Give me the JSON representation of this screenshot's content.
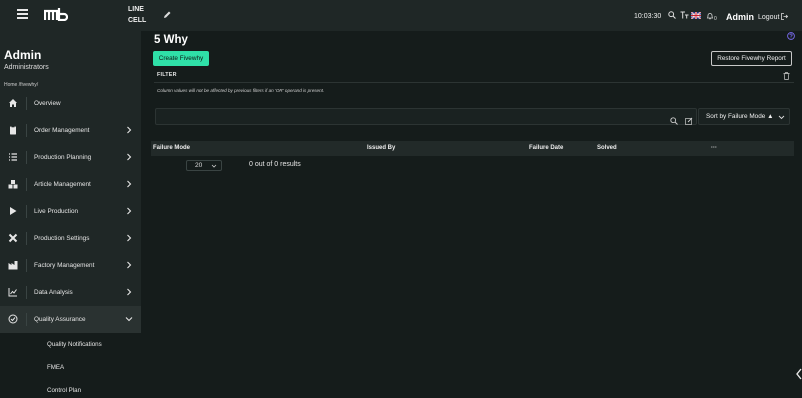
{
  "topbar": {
    "line_label": "LINE",
    "cell_label": "CELL",
    "time": "10:03:30",
    "notification_count": "0",
    "user": "Admin",
    "logout_label": "Logout"
  },
  "sidebar": {
    "user_name": "Admin",
    "user_role": "Administrators",
    "breadcrumb": "Home /fivewhy/",
    "items": [
      {
        "label": "Overview",
        "icon": "home-icon"
      },
      {
        "label": "Order Management",
        "icon": "clipboard-icon"
      },
      {
        "label": "Production Planning",
        "icon": "list-icon"
      },
      {
        "label": "Article Management",
        "icon": "boxes-icon"
      },
      {
        "label": "Live Production",
        "icon": "play-icon"
      },
      {
        "label": "Production Settings",
        "icon": "tools-icon"
      },
      {
        "label": "Factory Management",
        "icon": "factory-icon"
      },
      {
        "label": "Data Analysis",
        "icon": "chart-icon"
      },
      {
        "label": "Quality Assurance",
        "icon": "check-circle-icon"
      }
    ],
    "subitems": [
      {
        "label": "Quality Notifications"
      },
      {
        "label": "FMEA"
      },
      {
        "label": "Control Plan"
      }
    ]
  },
  "main": {
    "title": "5 Why",
    "create_button": "Create Fivewhy",
    "restore_button": "Restore Fivewhy Report",
    "filter_label": "FILTER",
    "filter_note": "Column values will not be affected by previous filters if an 'OR' operand is present.",
    "search_value": "",
    "sort_label": "Sort by Failure Mode ▲",
    "columns": [
      "Failure Mode",
      "Issued By",
      "Failure Date",
      "Solved",
      "···"
    ],
    "page_size": "20",
    "results_text": "0 out of 0 results"
  },
  "colors": {
    "accent": "#2fe0a8",
    "sidebar_bg": "#1f2726",
    "page_bg": "#151c1b",
    "help_icon": "#7b6cf0"
  }
}
